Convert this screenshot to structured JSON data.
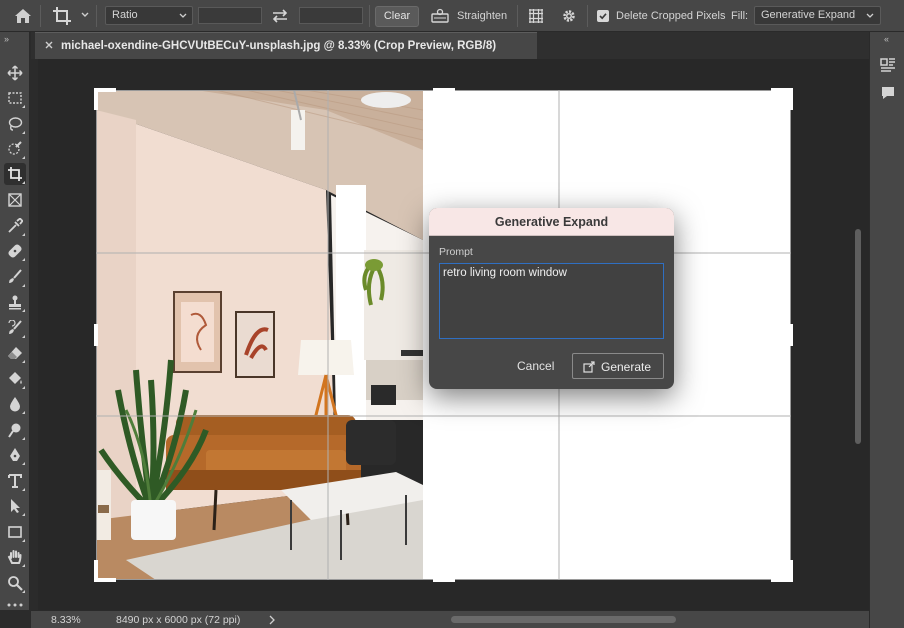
{
  "options_bar": {
    "ratio_select": "Ratio",
    "width_value": "",
    "height_value": "",
    "clear_label": "Clear",
    "straighten_label": "Straighten",
    "delete_cropped_label": "Delete Cropped Pixels",
    "delete_cropped_checked": true,
    "fill_label": "Fill:",
    "fill_value": "Generative Expand"
  },
  "document_tab": {
    "title": "michael-oxendine-GHCVUtBECuY-unsplash.jpg @ 8.33% (Crop Preview, RGB/8)"
  },
  "toolbar": {
    "tools": [
      "move-tool",
      "marquee-tool",
      "lasso-tool",
      "quick-selection-tool",
      "crop-tool",
      "frame-tool",
      "eyedropper-tool",
      "spot-healing-tool",
      "brush-tool",
      "clone-stamp-tool",
      "history-brush-tool",
      "eraser-tool",
      "paint-bucket-tool",
      "blur-tool",
      "dodge-tool",
      "pen-tool",
      "type-tool",
      "path-selection-tool",
      "rectangle-tool",
      "hand-tool",
      "zoom-tool"
    ],
    "active_tool": "crop-tool"
  },
  "dialog": {
    "title": "Generative Expand",
    "prompt_label": "Prompt",
    "prompt_value": "retro living room window",
    "cancel_label": "Cancel",
    "generate_label": "Generate"
  },
  "status_bar": {
    "zoom": "8.33%",
    "doc_info": "8490 px x 6000 px (72 ppi)"
  }
}
